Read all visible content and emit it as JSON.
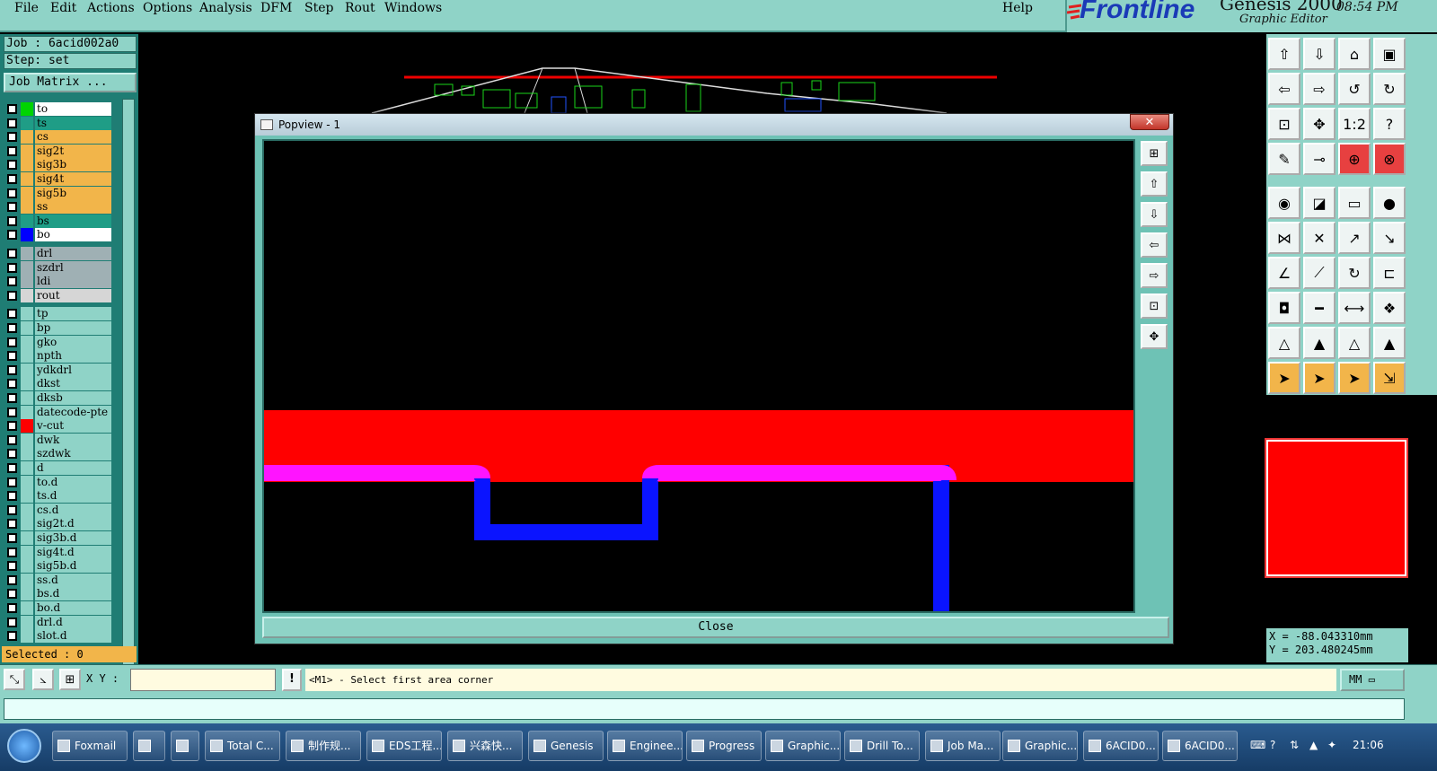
{
  "menu": {
    "items": [
      "File",
      "Edit",
      "Actions",
      "Options",
      "Analysis",
      "DFM",
      "Step",
      "Rout",
      "Windows"
    ],
    "help": "Help"
  },
  "brand": {
    "logo": "Frontline",
    "product": "Genesis 2000",
    "subtitle": "Graphic Editor",
    "time": "08:54  PM"
  },
  "job": {
    "job_label": "Job :  6acid002a0",
    "step_label": "Step:  set",
    "matrix_button": "Job Matrix ..."
  },
  "layers": [
    {
      "name": "to",
      "swatch": "#00d400",
      "bg": "#ffffff"
    },
    {
      "name": "ts",
      "swatch": "#1f9d86",
      "bg": "#1f9d86"
    },
    {
      "name": "cs",
      "swatch": "#f2b54a",
      "bg": "#f2b54a"
    },
    {
      "name": "sig2t",
      "swatch": "#f2b54a",
      "bg": "#f2b54a"
    },
    {
      "name": "sig3b",
      "swatch": "#f2b54a",
      "bg": "#f2b54a"
    },
    {
      "name": "sig4t",
      "swatch": "#f2b54a",
      "bg": "#f2b54a"
    },
    {
      "name": "sig5b",
      "swatch": "#f2b54a",
      "bg": "#f2b54a"
    },
    {
      "name": "ss",
      "swatch": "#f2b54a",
      "bg": "#f2b54a"
    },
    {
      "name": "bs",
      "swatch": "#1f9d86",
      "bg": "#1f9d86"
    },
    {
      "name": "bo",
      "swatch": "#0000ff",
      "bg": "#ffffff"
    },
    {
      "name": "drl",
      "swatch": "#9fb0b4",
      "bg": "#9fb0b4"
    },
    {
      "name": "szdrl",
      "swatch": "#9fb0b4",
      "bg": "#9fb0b4"
    },
    {
      "name": "ldi",
      "swatch": "#9fb0b4",
      "bg": "#9fb0b4"
    },
    {
      "name": "rout",
      "swatch": "#d6d6d6",
      "bg": "#d6d6d6"
    },
    {
      "name": "tp",
      "swatch": "#8fd3c7",
      "bg": "#8fd3c7"
    },
    {
      "name": "bp",
      "swatch": "#8fd3c7",
      "bg": "#8fd3c7"
    },
    {
      "name": "gko",
      "swatch": "#8fd3c7",
      "bg": "#8fd3c7"
    },
    {
      "name": "npth",
      "swatch": "#8fd3c7",
      "bg": "#8fd3c7"
    },
    {
      "name": "ydkdrl",
      "swatch": "#8fd3c7",
      "bg": "#8fd3c7"
    },
    {
      "name": "dkst",
      "swatch": "#8fd3c7",
      "bg": "#8fd3c7"
    },
    {
      "name": "dksb",
      "swatch": "#8fd3c7",
      "bg": "#8fd3c7"
    },
    {
      "name": "datecode-pte",
      "swatch": "#8fd3c7",
      "bg": "#8fd3c7"
    },
    {
      "name": "v-cut",
      "swatch": "#ff0000",
      "bg": "#8fd3c7"
    },
    {
      "name": "dwk",
      "swatch": "#8fd3c7",
      "bg": "#8fd3c7"
    },
    {
      "name": "szdwk",
      "swatch": "#8fd3c7",
      "bg": "#8fd3c7"
    },
    {
      "name": "d",
      "swatch": "#8fd3c7",
      "bg": "#8fd3c7"
    },
    {
      "name": "to.d",
      "swatch": "#8fd3c7",
      "bg": "#8fd3c7"
    },
    {
      "name": "ts.d",
      "swatch": "#8fd3c7",
      "bg": "#8fd3c7"
    },
    {
      "name": "cs.d",
      "swatch": "#8fd3c7",
      "bg": "#8fd3c7"
    },
    {
      "name": "sig2t.d",
      "swatch": "#8fd3c7",
      "bg": "#8fd3c7"
    },
    {
      "name": "sig3b.d",
      "swatch": "#8fd3c7",
      "bg": "#8fd3c7"
    },
    {
      "name": "sig4t.d",
      "swatch": "#8fd3c7",
      "bg": "#8fd3c7"
    },
    {
      "name": "sig5b.d",
      "swatch": "#8fd3c7",
      "bg": "#8fd3c7"
    },
    {
      "name": "ss.d",
      "swatch": "#8fd3c7",
      "bg": "#8fd3c7"
    },
    {
      "name": "bs.d",
      "swatch": "#8fd3c7",
      "bg": "#8fd3c7"
    },
    {
      "name": "bo.d",
      "swatch": "#8fd3c7",
      "bg": "#8fd3c7"
    },
    {
      "name": "drl.d",
      "swatch": "#8fd3c7",
      "bg": "#8fd3c7"
    },
    {
      "name": "slot.d",
      "swatch": "#8fd3c7",
      "bg": "#8fd3c7"
    }
  ],
  "selected": "Selected : 0",
  "popview": {
    "title": "Popview - 1",
    "close_x": "✕",
    "close_button": "Close"
  },
  "coords": {
    "x": "X = -88.043310mm",
    "y": "Y = 203.480245mm"
  },
  "command": {
    "xy_label": "X Y :",
    "xy_value": "",
    "bang": "!",
    "prompt": "<M1> - Select first area corner",
    "unit": "MM"
  },
  "taskbar": {
    "tasks": [
      "Foxmail",
      "",
      "",
      "Total C...",
      "制作规...",
      "EDS工程...",
      "兴森快...",
      "Genesis",
      "Enginee...",
      "Progress",
      "Graphic...",
      "Drill To...",
      "Job Ma...",
      "Graphic...",
      "6ACID0...",
      "6ACID0..."
    ],
    "clock": "21:06"
  }
}
